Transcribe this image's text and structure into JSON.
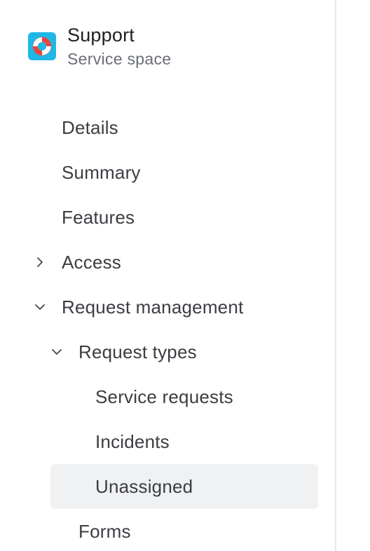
{
  "space": {
    "title": "Support",
    "subtitle": "Service space",
    "avatar_icon": "lifebuoy-icon",
    "avatar_color": "#1fb8e6"
  },
  "nav": {
    "details": "Details",
    "summary": "Summary",
    "features": "Features",
    "access": "Access",
    "request_management": "Request management",
    "request_types": "Request types",
    "service_requests": "Service requests",
    "incidents": "Incidents",
    "unassigned": "Unassigned",
    "forms": "Forms"
  },
  "state": {
    "access_expanded": false,
    "request_management_expanded": true,
    "request_types_expanded": true,
    "selected": "Unassigned"
  },
  "colors": {
    "selected_bg": "#f0f1f2",
    "text": "#3b3d42",
    "muted": "#6b6e76"
  }
}
